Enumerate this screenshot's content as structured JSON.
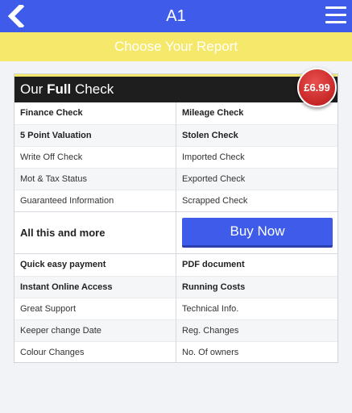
{
  "header": {
    "title": "A1"
  },
  "subheader": {
    "text": "Choose Your Report"
  },
  "card": {
    "title_prefix": "Our ",
    "title_bold": "Full",
    "title_suffix": " Check",
    "price": "£6.99",
    "top_rows": [
      [
        "Finance Check",
        "Mileage Check"
      ],
      [
        "5 Point Valuation",
        "Stolen Check"
      ],
      [
        "Write Off Check",
        "Imported Check"
      ],
      [
        "Mot & Tax Status",
        "Exported Check"
      ],
      [
        "Guaranteed Information",
        "Scrapped Check"
      ]
    ],
    "cta_text": "All this and more",
    "buy_label": "Buy Now",
    "bottom_rows": [
      [
        "Quick easy payment",
        "PDF document"
      ],
      [
        "Instant Online Access",
        "Running Costs"
      ],
      [
        "Great Support",
        "Technical Info."
      ],
      [
        "Keeper change Date",
        "Reg. Changes"
      ],
      [
        "Colour Changes",
        "No. Of owners"
      ]
    ]
  },
  "colors": {
    "primary": "#3e5bea",
    "banner": "#f5e86a",
    "badge": "#c92a29",
    "card_header": "#1e1e1e"
  },
  "icons": {
    "back": "chevron-left-icon",
    "menu": "hamburger-menu-icon"
  }
}
